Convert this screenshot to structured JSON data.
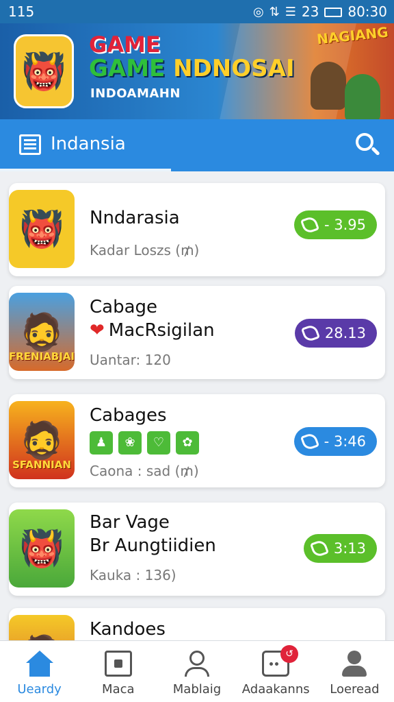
{
  "status_bar": {
    "left": "115",
    "right_icons": [
      "notification-icon",
      "sync-icon",
      "wifi-icon",
      "signal-icon"
    ],
    "battery_text": "23",
    "time": "80:30"
  },
  "banner": {
    "line1": "GAME",
    "line2_a": "GAME ",
    "line2_b": "NDNOSAI",
    "line3": "INDOAMAHN",
    "corner_tag": "NAGIANG"
  },
  "header": {
    "title": "Indansia",
    "menu_icon": "menu-icon",
    "search_icon": "search-icon"
  },
  "games": [
    {
      "name": "Nndarasia",
      "meta": "Kadar Loszs (₥)",
      "pill": "- 3.95",
      "pill_color": "#5bbf2a"
    },
    {
      "name": "Cabage",
      "subname": "MacRsigilan",
      "meta": "Uantar: 120",
      "pill": "28.13",
      "pill_color": "#5a3aa8",
      "thumb_caption": "FRENIABJAII"
    },
    {
      "name": "Cabages",
      "tags": [
        "♟",
        "❀",
        "♡",
        "✿"
      ],
      "meta": "Caona : sad (₥)",
      "pill": "- 3:46",
      "pill_color": "#2b8ae0",
      "thumb_caption": "SFANNIAN"
    },
    {
      "name": "Bar Vage",
      "subname": "Br Aungtiidien",
      "meta": "Kauka : 136)",
      "pill": "3:13",
      "pill_color": "#5bbf2a"
    },
    {
      "name": "Kandoes"
    }
  ],
  "bottom_nav": [
    {
      "label": "Ueardy",
      "icon": "home-icon",
      "active": true
    },
    {
      "label": "Maca",
      "icon": "square-icon",
      "active": false
    },
    {
      "label": "Mablaig",
      "icon": "profile-outline-icon",
      "active": false
    },
    {
      "label": "Adaakanns",
      "icon": "chat-icon",
      "active": false,
      "badge": "↺"
    },
    {
      "label": "Loeread",
      "icon": "person-icon",
      "active": false
    }
  ],
  "colors": {
    "primary": "#2b8ae0",
    "green": "#5bbf2a",
    "purple": "#5a3aa8",
    "badge_red": "#e0233a"
  }
}
